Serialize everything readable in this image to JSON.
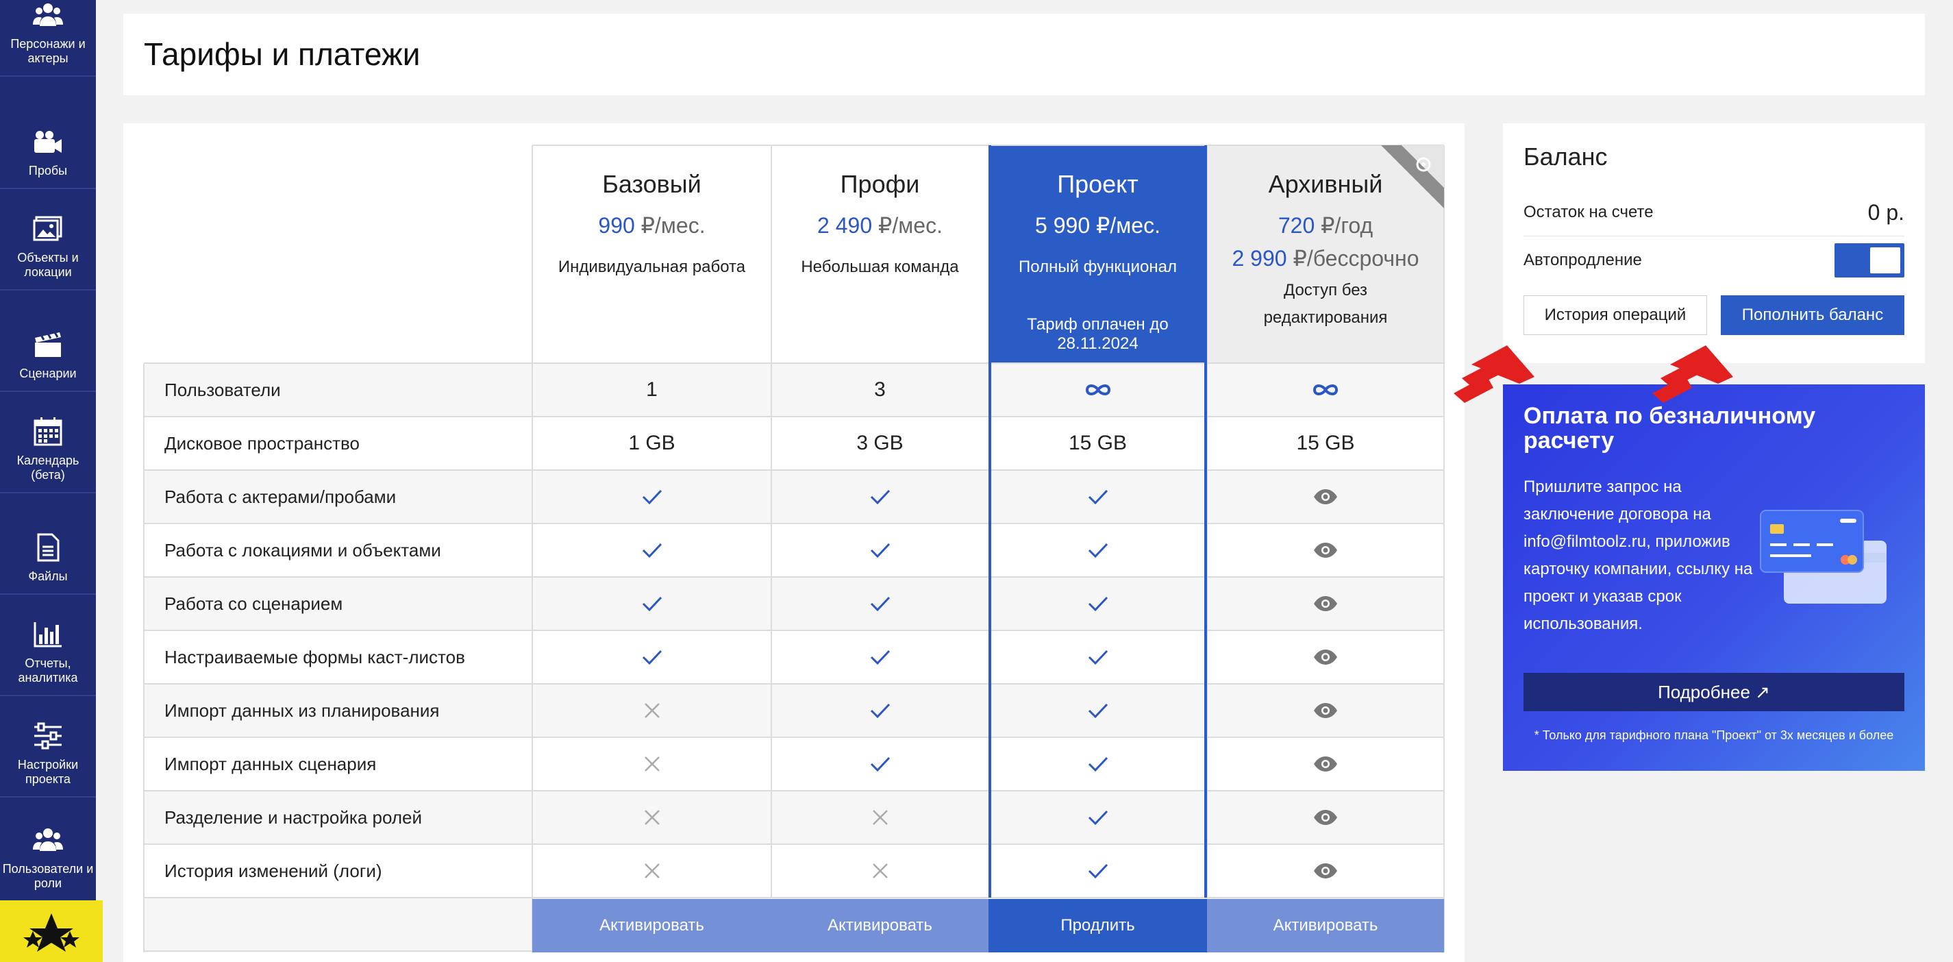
{
  "sidebar": {
    "items": [
      {
        "label": "Персонажи и\nактеры",
        "icon": "users-icon"
      },
      {
        "label": "Пробы",
        "icon": "video-camera-icon"
      },
      {
        "label": "Объекты и\nлокации",
        "icon": "image-icon"
      },
      {
        "label": "Сценарии",
        "icon": "clapperboard-icon"
      },
      {
        "label": "Календарь\n(бета)",
        "icon": "calendar-icon"
      },
      {
        "label": "Файлы",
        "icon": "file-icon"
      },
      {
        "label": "Отчеты,\nаналитика",
        "icon": "bar-chart-icon"
      },
      {
        "label": "Настройки\nпроекта",
        "icon": "sliders-icon"
      },
      {
        "label": "Пользователи и\nроли",
        "icon": "users-icon"
      }
    ]
  },
  "page": {
    "title": "Тарифы и платежи"
  },
  "plans": [
    {
      "name": "Базовый",
      "price": "990",
      "unit": "₽/мес.",
      "price2": "",
      "unit2": "",
      "desc": "Индивидуальная работа",
      "note": "",
      "button": "Активировать"
    },
    {
      "name": "Профи",
      "price": "2 490",
      "unit": "₽/мес.",
      "price2": "",
      "unit2": "",
      "desc": "Небольшая команда",
      "note": "",
      "button": "Активировать"
    },
    {
      "name": "Проект",
      "price": "5 990",
      "unit": "₽/мес.",
      "price2": "",
      "unit2": "",
      "desc": "Полный функционал",
      "note": "Тариф оплачен до 28.11.2024",
      "button": "Продлить"
    },
    {
      "name": "Архивный",
      "price": "720",
      "unit": "₽/год",
      "price2": "2 990",
      "unit2": "₽/бессрочно",
      "desc": "Доступ без редактирования",
      "note": "",
      "button": "Активировать"
    }
  ],
  "features": [
    {
      "label": "Пользователи",
      "values": [
        "1",
        "3",
        "∞",
        "∞"
      ]
    },
    {
      "label": "Дисковое пространство",
      "values": [
        "1 GB",
        "3 GB",
        "15 GB",
        "15 GB"
      ]
    },
    {
      "label": "Работа с актерами/пробами",
      "values": [
        "check",
        "check",
        "check",
        "eye"
      ]
    },
    {
      "label": "Работа с локациями и объектами",
      "values": [
        "check",
        "check",
        "check",
        "eye"
      ]
    },
    {
      "label": "Работа со сценарием",
      "values": [
        "check",
        "check",
        "check",
        "eye"
      ]
    },
    {
      "label": "Настраиваемые формы каст-листов",
      "values": [
        "check",
        "check",
        "check",
        "eye"
      ]
    },
    {
      "label": "Импорт данных из планирования",
      "values": [
        "cross",
        "check",
        "check",
        "eye"
      ]
    },
    {
      "label": "Импорт данных сценария",
      "values": [
        "cross",
        "check",
        "check",
        "eye"
      ]
    },
    {
      "label": "Разделение и настройка ролей",
      "values": [
        "cross",
        "cross",
        "check",
        "eye"
      ]
    },
    {
      "label": "История изменений (логи)",
      "values": [
        "cross",
        "cross",
        "check",
        "eye"
      ]
    }
  ],
  "balance": {
    "title": "Баланс",
    "remaining_label": "Остаток на счете",
    "remaining_value": "0 р.",
    "autorenew_label": "Автопродление",
    "history_button": "История операций",
    "topup_button": "Пополнить баланс"
  },
  "promo": {
    "title": "Оплата по безналичному расчету",
    "text": "Пришлите запрос на заключение договора на info@filmtoolz.ru, приложив карточку компании, ссылку на проект и указав срок использования.",
    "button": "Подробнее ↗",
    "footnote": "* Только для тарифного плана \"Проект\" от 3х месяцев и более"
  },
  "colors": {
    "sidebar": "#1f2b73",
    "accent": "#2b5bc4",
    "check": "#2b56c6",
    "logo": "#f2e21c",
    "annotation": "#e32020"
  }
}
